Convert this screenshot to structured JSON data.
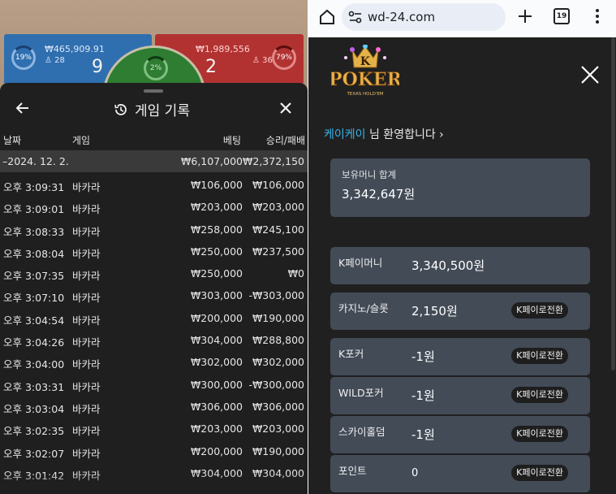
{
  "left": {
    "bet_bar": {
      "player": {
        "percent": "19%",
        "amount": "₩465,909.91",
        "count": "28",
        "score": "9"
      },
      "banker": {
        "percent": "79%",
        "amount": "₩1,989,556",
        "count": "36",
        "score": "2"
      },
      "tie": {
        "percent": "2%"
      }
    },
    "sheet": {
      "title": "게임 기록",
      "columns": {
        "date": "날짜",
        "game": "게임",
        "bet": "베팅",
        "result": "승리/패배"
      },
      "date_row": {
        "date": "–2024. 12. 2.",
        "bet": "₩6,107,000",
        "result": "₩2,372,150"
      },
      "rows": [
        {
          "time": "오후 3:09:31",
          "game": "바카라",
          "bet": "₩106,000",
          "result": "₩106,000"
        },
        {
          "time": "오후 3:09:01",
          "game": "바카라",
          "bet": "₩203,000",
          "result": "₩203,000"
        },
        {
          "time": "오후 3:08:33",
          "game": "바카라",
          "bet": "₩258,000",
          "result": "₩245,100"
        },
        {
          "time": "오후 3:08:04",
          "game": "바카라",
          "bet": "₩250,000",
          "result": "₩237,500"
        },
        {
          "time": "오후 3:07:35",
          "game": "바카라",
          "bet": "₩250,000",
          "result": "₩0"
        },
        {
          "time": "오후 3:07:10",
          "game": "바카라",
          "bet": "₩303,000",
          "result": "-₩303,000"
        },
        {
          "time": "오후 3:04:54",
          "game": "바카라",
          "bet": "₩200,000",
          "result": "₩190,000"
        },
        {
          "time": "오후 3:04:26",
          "game": "바카라",
          "bet": "₩304,000",
          "result": "₩288,800"
        },
        {
          "time": "오후 3:04:00",
          "game": "바카라",
          "bet": "₩302,000",
          "result": "₩302,000"
        },
        {
          "time": "오후 3:03:31",
          "game": "바카라",
          "bet": "₩300,000",
          "result": "-₩300,000"
        },
        {
          "time": "오후 3:03:04",
          "game": "바카라",
          "bet": "₩306,000",
          "result": "₩306,000"
        },
        {
          "time": "오후 3:02:35",
          "game": "바카라",
          "bet": "₩203,000",
          "result": "₩203,000"
        },
        {
          "time": "오후 3:02:07",
          "game": "바카라",
          "bet": "₩200,000",
          "result": "₩190,000"
        },
        {
          "time": "오후 3:01:42",
          "game": "바카라",
          "bet": "₩304,000",
          "result": "₩304,000"
        }
      ]
    }
  },
  "right": {
    "browser": {
      "url": "wd-24.com",
      "tab_count": "19"
    },
    "logo": {
      "letter": "K",
      "word": "POKER",
      "tagline": "TEXAS HOLD'EM"
    },
    "welcome": {
      "nickname": "케이케이",
      "suffix": " 님 환영합니다 ›"
    },
    "total": {
      "label": "보유머니 합계",
      "value": "3,342,647원"
    },
    "balances": [
      {
        "label": "K페이머니",
        "value": "3,340,500원",
        "button": ""
      },
      {
        "label": "카지노/슬롯",
        "value": "2,150원",
        "button": "K페이로전환"
      },
      {
        "label": "K포커",
        "value": "-1원",
        "button": "K페이로전환"
      },
      {
        "label": "WILD포커",
        "value": "-1원",
        "button": "K페이로전환"
      },
      {
        "label": "스카이홀덤",
        "value": "-1원",
        "button": "K페이로전환"
      },
      {
        "label": "포인트",
        "value": "0",
        "button": "K페이로전환"
      }
    ]
  }
}
